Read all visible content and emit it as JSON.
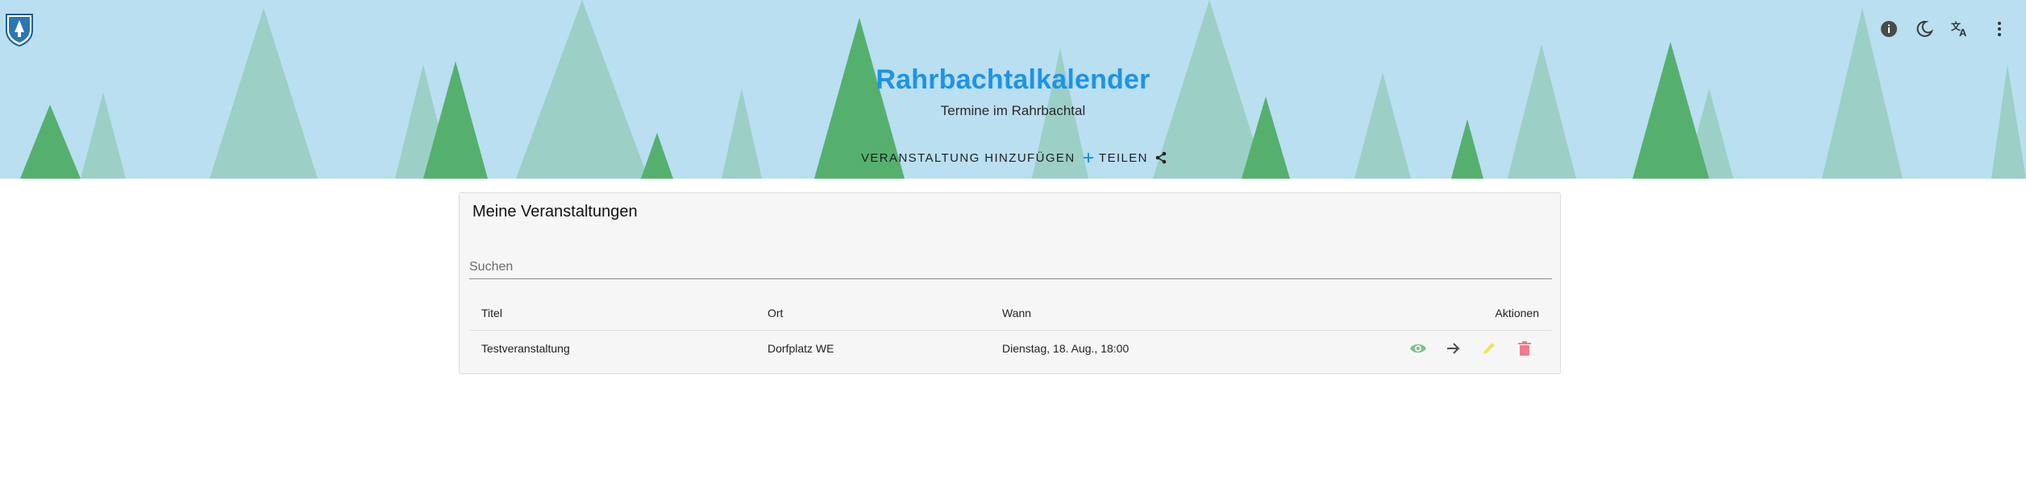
{
  "header": {
    "title": "Rahrbachtalkalender",
    "subtitle": "Termine im Rahrbachtal",
    "nav": {
      "add_event_label": "VERANSTALTUNG HINZUFÜGEN",
      "share_label": "TEILEN"
    },
    "icons": [
      "info-icon",
      "dark-mode-icon",
      "translate-icon",
      "more-vert-icon"
    ]
  },
  "card": {
    "title": "Meine Veranstaltungen",
    "search": {
      "placeholder": "Suchen",
      "value": ""
    },
    "table": {
      "columns": [
        "Titel",
        "Ort",
        "Wann",
        "Aktionen"
      ],
      "rows": [
        {
          "title": "Testveranstaltung",
          "ort": "Dorfplatz WE",
          "wann": "Dienstag, 18. Aug., 18:00",
          "actions": [
            "view-icon",
            "arrow-right-icon",
            "edit-icon",
            "delete-icon"
          ]
        }
      ]
    }
  },
  "colors": {
    "header_sky": "#b9dff0",
    "title_blue": "#1e93e6",
    "tree_dark": "#55b06e",
    "tree_light": "#9ccfc6",
    "view_green": "#78c38a",
    "edit_yellow": "#f1e35a",
    "delete_red": "#f07b8a"
  }
}
